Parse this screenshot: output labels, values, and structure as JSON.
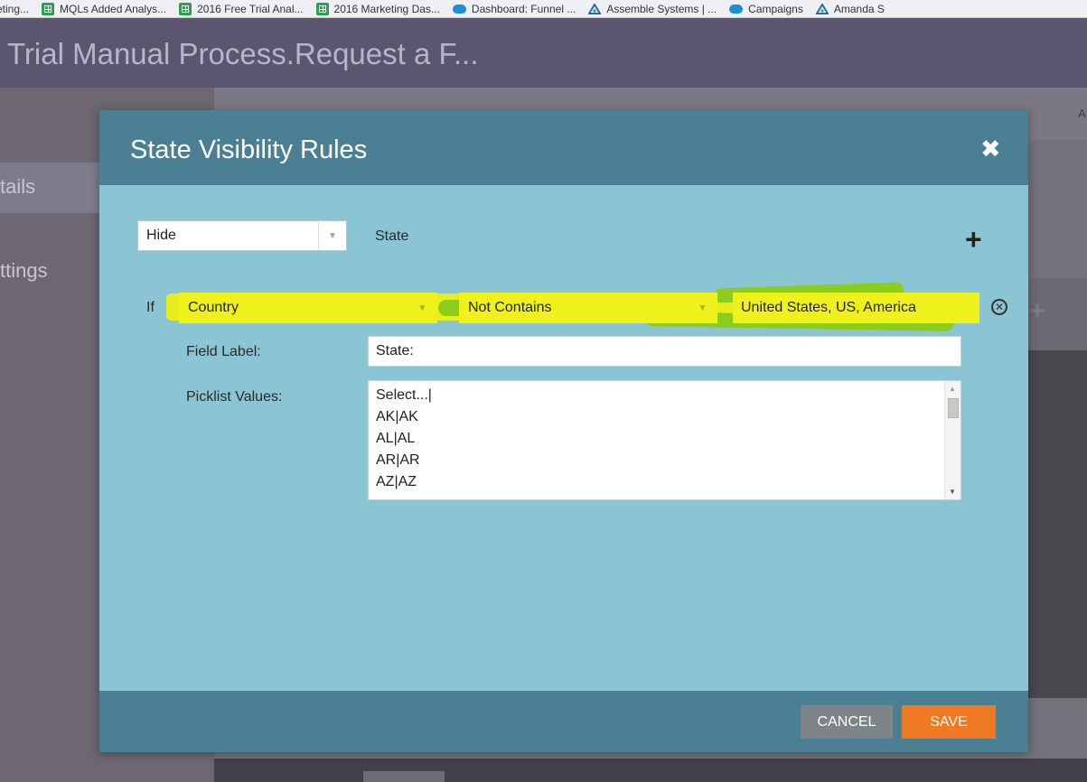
{
  "bookmarks": [
    {
      "label": "eting...",
      "icon": "none"
    },
    {
      "label": "MQLs Added Analys...",
      "icon": "sheets-icon"
    },
    {
      "label": "2016 Free Trial Anal...",
      "icon": "sheets-icon"
    },
    {
      "label": "2016 Marketing Das...",
      "icon": "sheets-icon"
    },
    {
      "label": "Dashboard: Funnel ...",
      "icon": "salesforce-cloud-icon"
    },
    {
      "label": "Assemble Systems | ...",
      "icon": "assemble-logo-icon"
    },
    {
      "label": "Campaigns",
      "icon": "salesforce-cloud-icon"
    },
    {
      "label": "Amanda S",
      "icon": "assemble-logo-icon"
    }
  ],
  "app": {
    "title": "Trial Manual Process.Request a F...",
    "nav_details": "tails",
    "nav_settings": "ttings",
    "topbar_letter": "A"
  },
  "modal": {
    "title": "State Visibility Rules",
    "action_select": "Hide",
    "target_field": "State",
    "if_label": "If",
    "condition_field": "Country",
    "condition_operator": "Not Contains",
    "condition_value": "United States, US, America",
    "field_label_caption": "Field Label:",
    "field_label_value": "State:",
    "picklist_caption": "Picklist Values:",
    "picklist_values": [
      "Select...|",
      "AK|AK",
      "AL|AL",
      "AR|AR",
      "AZ|AZ"
    ],
    "cancel_label": "CANCEL",
    "save_label": "SAVE"
  },
  "colors": {
    "header_bg": "#5b5570",
    "modal_header": "#4b8094",
    "modal_body": "#8bc4d2",
    "highlight_yellow": "#eef21a",
    "highlight_green": "#8ccc1a",
    "save_orange": "#ef7a23",
    "cancel_gray": "#7e8588"
  }
}
